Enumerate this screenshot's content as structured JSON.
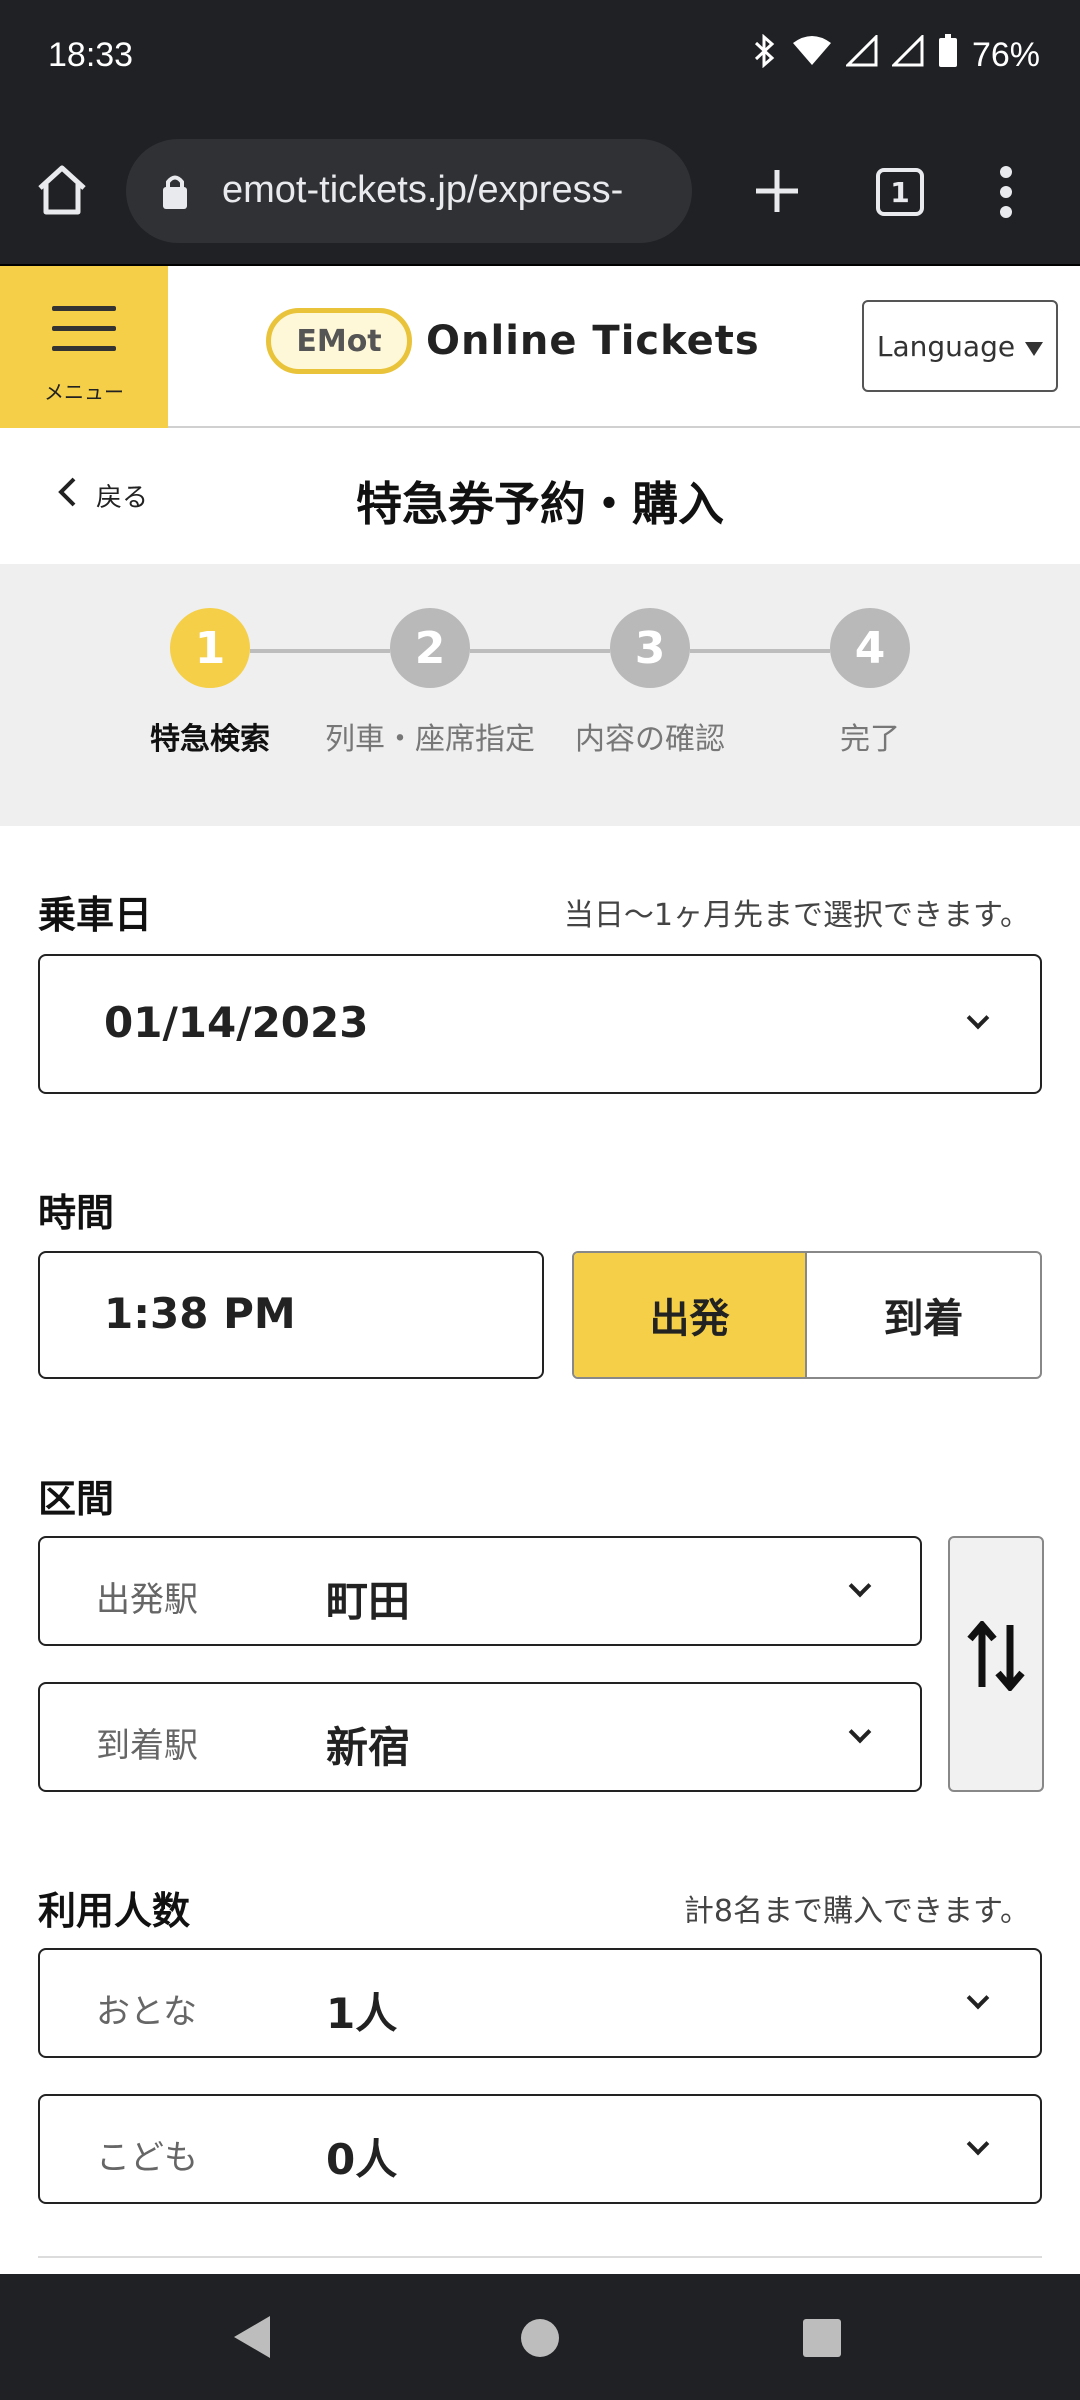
{
  "status_bar": {
    "time": "18:33",
    "battery": "76%"
  },
  "browser": {
    "url": "emot-tickets.jp/express-",
    "tab_count": "1"
  },
  "header": {
    "menu_label": "メニュー",
    "logo_badge": "EMot",
    "logo_text": "Online Tickets",
    "language_label": "Language"
  },
  "title_row": {
    "back_label": "戻る",
    "page_title": "特急券予約・購入"
  },
  "stepper": {
    "steps": [
      {
        "num": "1",
        "label": "特急検索"
      },
      {
        "num": "2",
        "label": "列車・座席指定"
      },
      {
        "num": "3",
        "label": "内容の確認"
      },
      {
        "num": "4",
        "label": "完了"
      }
    ],
    "active_step": 1
  },
  "form": {
    "date": {
      "label": "乗車日",
      "hint": "当日〜1ヶ月先まで選択できます。",
      "value": "01/14/2023"
    },
    "time": {
      "label": "時間",
      "value": "1:38 PM",
      "depart_label": "出発",
      "arrive_label": "到着",
      "selected": "出発"
    },
    "section": {
      "label": "区間",
      "from_label": "出発駅",
      "from_value": "町田",
      "to_label": "到着駅",
      "to_value": "新宿"
    },
    "passengers": {
      "label": "利用人数",
      "hint": "計8名まで購入できます。",
      "adult_label": "おとな",
      "adult_value": "1人",
      "child_label": "こども",
      "child_value": "0人"
    }
  },
  "colors": {
    "accent": "#f5cf47",
    "dark_bar": "#202124",
    "stepper_bg": "#efefef"
  }
}
